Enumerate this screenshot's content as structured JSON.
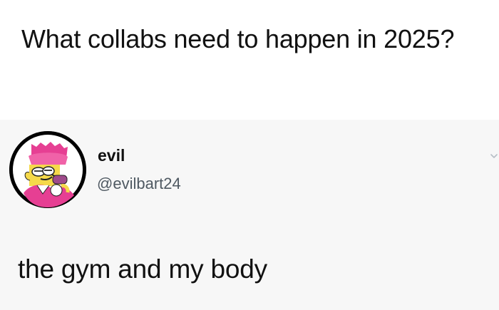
{
  "caption": {
    "text": "What collabs need to happen in 2025?"
  },
  "tweet": {
    "author": {
      "display_name": "evil",
      "handle": "@evilbart24",
      "avatar_icon": "bart-simpson-avatar-icon"
    },
    "body": "the gym and my body",
    "menu_icon": "chevron-down-icon"
  },
  "colors": {
    "background": "#ffffff",
    "tweet_background": "#f7f7f7",
    "text": "#111111",
    "handle_text": "#4f5962",
    "avatar_pink": "#e63f93",
    "avatar_yellow": "#f5d94a"
  }
}
